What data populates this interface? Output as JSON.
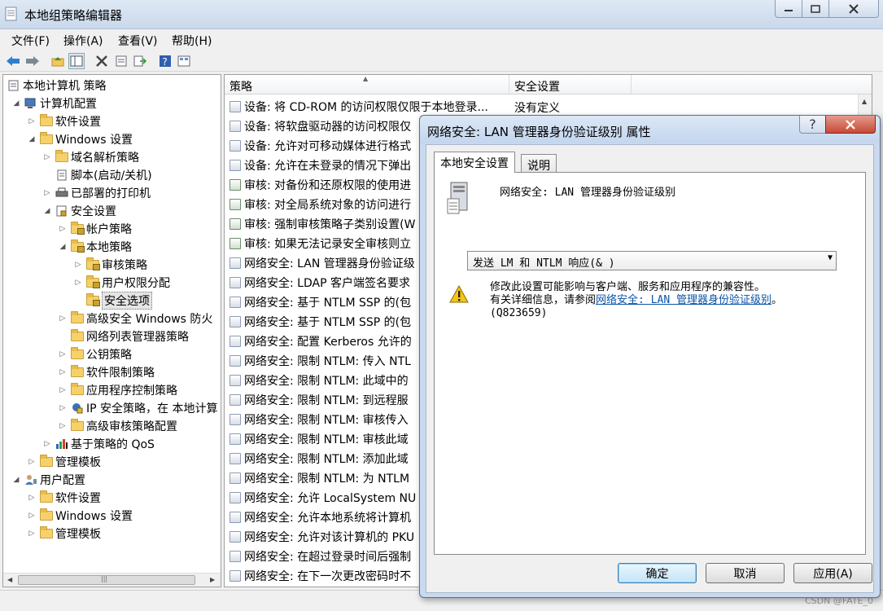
{
  "window": {
    "title": "本地组策略编辑器"
  },
  "menu": [
    "文件(F)",
    "操作(A)",
    "查看(V)",
    "帮助(H)"
  ],
  "tree": [
    {
      "label": "本地计算机 策略",
      "icon": "computer-policy-icon"
    },
    {
      "label": "计算机配置",
      "icon": "computer-icon"
    },
    {
      "label": "软件设置",
      "icon": "folder-icon"
    },
    {
      "label": "Windows 设置",
      "icon": "folder-icon"
    },
    {
      "label": "域名解析策略",
      "icon": "folder-icon"
    },
    {
      "label": "脚本(启动/关机)",
      "icon": "script-icon"
    },
    {
      "label": "已部署的打印机",
      "icon": "printer-icon"
    },
    {
      "label": "安全设置",
      "icon": "security-icon"
    },
    {
      "label": "帐户策略",
      "icon": "lock-folder-icon"
    },
    {
      "label": "本地策略",
      "icon": "lock-folder-icon"
    },
    {
      "label": "审核策略",
      "icon": "lock-folder-icon"
    },
    {
      "label": "用户权限分配",
      "icon": "lock-folder-icon"
    },
    {
      "label": "安全选项",
      "icon": "lock-folder-icon"
    },
    {
      "label": "高级安全 Windows 防火",
      "icon": "folder-icon"
    },
    {
      "label": "网络列表管理器策略",
      "icon": "folder-icon"
    },
    {
      "label": "公钥策略",
      "icon": "folder-icon"
    },
    {
      "label": "软件限制策略",
      "icon": "folder-icon"
    },
    {
      "label": "应用程序控制策略",
      "icon": "folder-icon"
    },
    {
      "label": "IP 安全策略，在 本地计算",
      "icon": "ip-security-icon"
    },
    {
      "label": "高级审核策略配置",
      "icon": "folder-icon"
    },
    {
      "label": "基于策略的 QoS",
      "icon": "qos-chart-icon"
    },
    {
      "label": "管理模板",
      "icon": "folder-icon"
    },
    {
      "label": "用户配置",
      "icon": "user-icon"
    },
    {
      "label": "软件设置",
      "icon": "folder-icon"
    },
    {
      "label": "Windows 设置",
      "icon": "folder-icon"
    },
    {
      "label": "管理模板",
      "icon": "folder-icon"
    }
  ],
  "list": {
    "headers": [
      "策略",
      "安全设置"
    ],
    "rows": [
      {
        "policy": "设备: 将 CD-ROM 的访问权限仅限于本地登录...",
        "setting": "没有定义"
      },
      {
        "policy": "设备: 将软盘驱动器的访问权限仅",
        "setting": ""
      },
      {
        "policy": "设备: 允许对可移动媒体进行格式",
        "setting": ""
      },
      {
        "policy": "设备: 允许在未登录的情况下弹出",
        "setting": ""
      },
      {
        "policy": "审核: 对备份和还原权限的使用进",
        "setting": ""
      },
      {
        "policy": "审核: 对全局系统对象的访问进行",
        "setting": ""
      },
      {
        "policy": "审核: 强制审核策略子类别设置(W",
        "setting": ""
      },
      {
        "policy": "审核: 如果无法记录安全审核则立",
        "setting": ""
      },
      {
        "policy": "网络安全: LAN 管理器身份验证级",
        "setting": ""
      },
      {
        "policy": "网络安全: LDAP 客户端签名要求",
        "setting": ""
      },
      {
        "policy": "网络安全: 基于 NTLM SSP 的(包",
        "setting": ""
      },
      {
        "policy": "网络安全: 基于 NTLM SSP 的(包",
        "setting": ""
      },
      {
        "policy": "网络安全: 配置 Kerberos 允许的",
        "setting": ""
      },
      {
        "policy": "网络安全: 限制 NTLM: 传入 NTL",
        "setting": ""
      },
      {
        "policy": "网络安全: 限制 NTLM: 此域中的",
        "setting": ""
      },
      {
        "policy": "网络安全: 限制 NTLM: 到远程服",
        "setting": ""
      },
      {
        "policy": "网络安全: 限制 NTLM: 审核传入",
        "setting": ""
      },
      {
        "policy": "网络安全: 限制 NTLM: 审核此域",
        "setting": ""
      },
      {
        "policy": "网络安全: 限制 NTLM: 添加此域",
        "setting": ""
      },
      {
        "policy": "网络安全: 限制 NTLM: 为 NTLM",
        "setting": ""
      },
      {
        "policy": "网络安全: 允许 LocalSystem NU",
        "setting": ""
      },
      {
        "policy": "网络安全: 允许本地系统将计算机",
        "setting": ""
      },
      {
        "policy": "网络安全: 允许对该计算机的 PKU",
        "setting": ""
      },
      {
        "policy": "网络安全: 在超过登录时间后强制",
        "setting": ""
      },
      {
        "policy": "网络安全: 在下一次更改密码时不",
        "setting": ""
      }
    ]
  },
  "dialog": {
    "title": "网络安全: LAN 管理器身份验证级别 属性",
    "tabs": [
      "本地安全设置",
      "说明"
    ],
    "policy_name": "网络安全: LAN 管理器身份验证级别",
    "selected_value": "发送 LM 和 NTLM 响应(& )",
    "warning_line1": "修改此设置可能影响与客户端、服务和应用程序的兼容性。",
    "warning_line2_prefix": "有关详细信息，请参阅",
    "warning_link": "网络安全: LAN 管理器身份验证级别",
    "warning_line2_suffix": "。",
    "warning_line3": "(Q823659)",
    "buttons": {
      "ok": "确定",
      "cancel": "取消",
      "apply": "应用(A)"
    }
  },
  "watermark": "CSDN @FATE_0"
}
